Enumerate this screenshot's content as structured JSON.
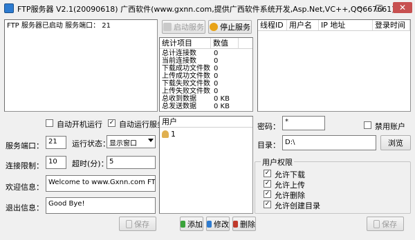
{
  "window": {
    "title": "FTP服务器 V2.1(20090618)  广西软件(www.gxnn.com,提供广西软件系统开发,Asp.Net,VC++,QQ667661)",
    "min_glyph": "–",
    "max_glyph": "□",
    "close_glyph": "✕",
    "accent": "#c75050"
  },
  "log": {
    "text": "FTP 服务器已启动 服务端口： 21"
  },
  "service_buttons": {
    "start_label": "启动服务",
    "stop_label": "停止服务"
  },
  "stats": {
    "header_item": "统计项目",
    "header_value": "数值",
    "rows": [
      {
        "label": "总计连接数",
        "value": "0"
      },
      {
        "label": "当前连接数",
        "value": "0"
      },
      {
        "label": "下载成功文件数",
        "value": "0"
      },
      {
        "label": "上传成功文件数",
        "value": "0"
      },
      {
        "label": "下载失败文件数",
        "value": "0"
      },
      {
        "label": "上传失败文件数",
        "value": "0"
      },
      {
        "label": "总收到数据",
        "value": "0 KB"
      },
      {
        "label": "总发送数据",
        "value": "0 KB"
      }
    ]
  },
  "connections": {
    "columns": [
      "线程ID",
      "用户名",
      "IP 地址",
      "登录时间"
    ]
  },
  "settings": {
    "autostart_label": "自动开机运行",
    "autostart_checked": false,
    "autorun_label": "自动运行服务",
    "autorun_checked": true,
    "port_label": "服务端口：",
    "port_value": "21",
    "run_state_label": "运行状态：",
    "run_state_value": "显示窗口",
    "conn_limit_label": "连接限制：",
    "conn_limit_value": "10",
    "timeout_label": "超时(分)：",
    "timeout_value": "5",
    "welcome_label": "欢迎信息：",
    "welcome_value": "Welcome to www.Gxnn.com FTP Server!",
    "exit_label": "退出信息：",
    "exit_value": "Good Bye!",
    "save_label": "保存"
  },
  "users": {
    "header": "用户",
    "items": [
      "1"
    ],
    "add_label": "添加",
    "edit_label": "修改",
    "delete_label": "删除"
  },
  "user_detail": {
    "password_label": "密码：",
    "password_value": "*",
    "disable_label": "禁用账户",
    "disable_checked": false,
    "dir_label": "目录：",
    "dir_value": "D:\\",
    "browse_label": "浏览",
    "perm_title": "用户权限",
    "permissions": [
      {
        "label": "允许下载",
        "checked": true
      },
      {
        "label": "允许上传",
        "checked": true
      },
      {
        "label": "允许删除",
        "checked": true
      },
      {
        "label": "允许创建目录",
        "checked": true
      }
    ],
    "save_label": "保存"
  }
}
